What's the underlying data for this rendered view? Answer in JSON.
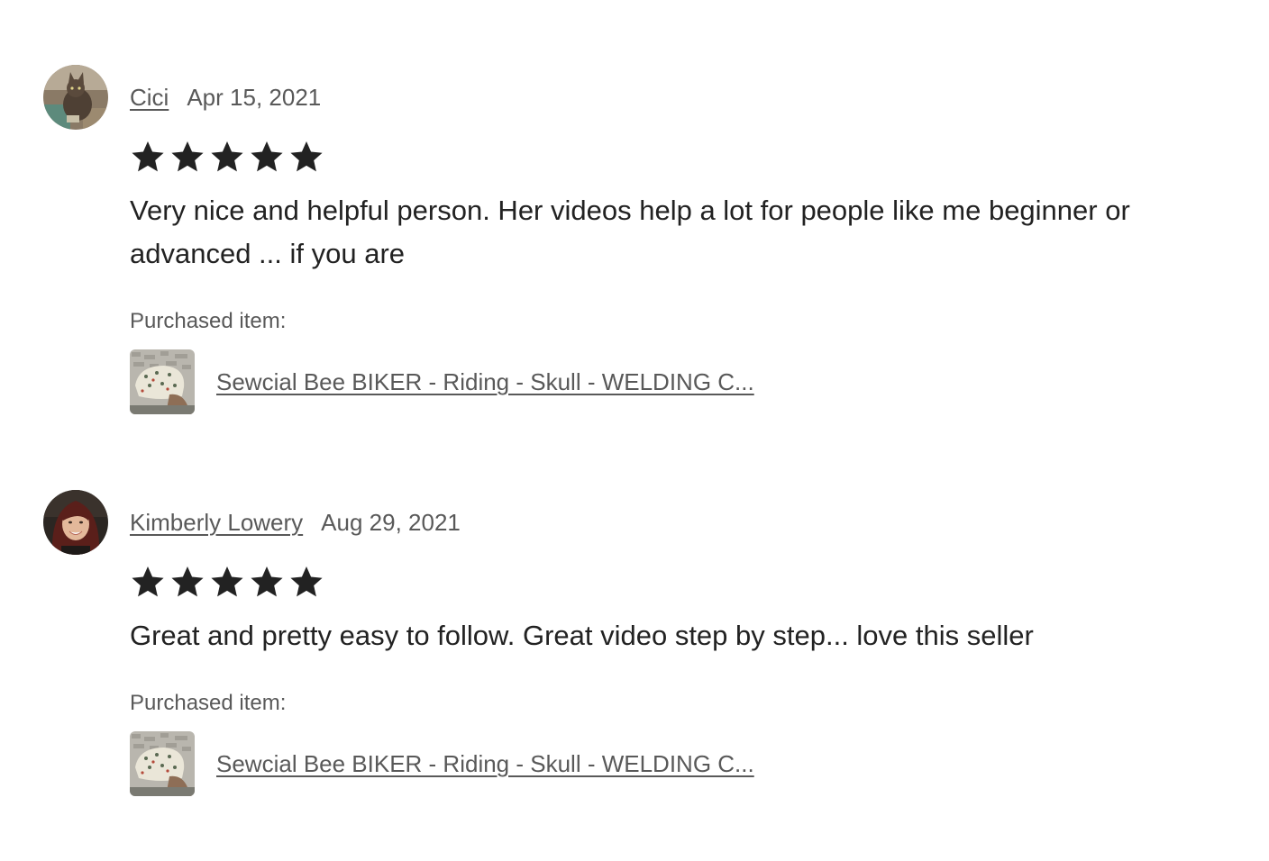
{
  "colors": {
    "text_primary": "#222222",
    "text_secondary": "#595959",
    "star": "#222222"
  },
  "reviews": [
    {
      "reviewer": "Cici",
      "date": "Apr 15, 2021",
      "rating": 5,
      "text": "Very nice and helpful person. Her videos help a lot for people like me beginner or advanced ... if you are",
      "purchased_label": "Purchased item:",
      "item_title": "Sewcial Bee BIKER - Riding - Skull - WELDING C...",
      "avatar_icon": "cat-photo-avatar"
    },
    {
      "reviewer": "Kimberly Lowery",
      "date": "Aug 29, 2021",
      "rating": 5,
      "text": "Great and pretty easy to follow. Great video step by step... love this seller",
      "purchased_label": "Purchased item:",
      "item_title": "Sewcial Bee BIKER - Riding - Skull - WELDING C...",
      "avatar_icon": "woman-photo-avatar"
    }
  ]
}
